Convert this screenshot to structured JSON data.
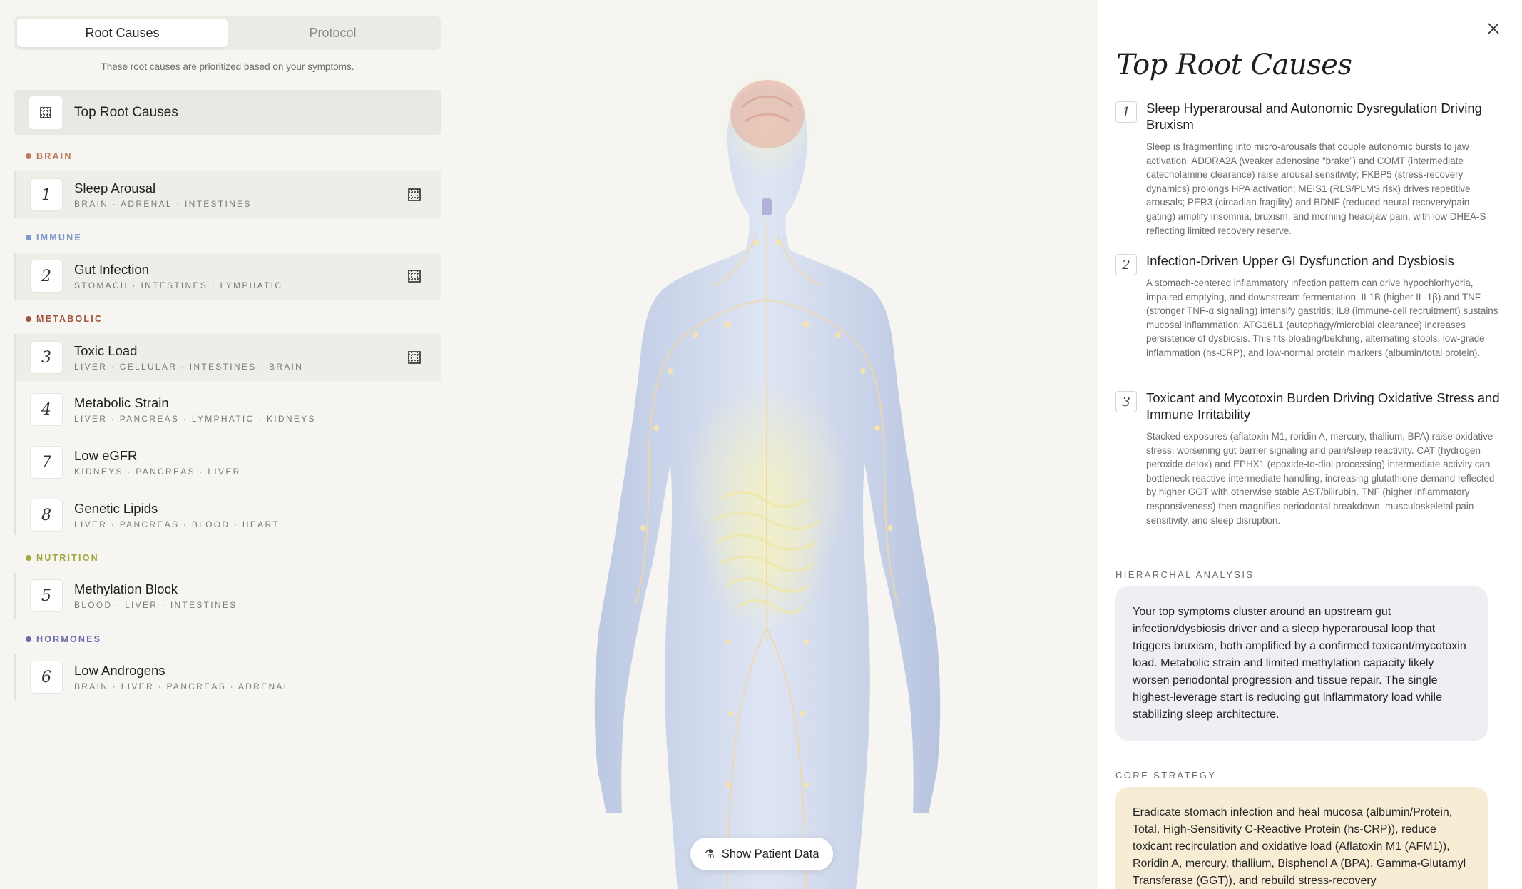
{
  "tabs": [
    {
      "label": "Root Causes",
      "active": true
    },
    {
      "label": "Protocol",
      "active": false
    }
  ],
  "subtitle": "These root causes are prioritized based on your symptoms.",
  "top_root_causes_label": "Top Root Causes",
  "categories": [
    {
      "name": "BRAIN",
      "color": "#c0775a"
    },
    {
      "name": "IMMUNE",
      "color": "#7a98c8"
    },
    {
      "name": "METABOLIC",
      "color": "#a0553c"
    },
    {
      "name": "NUTRITION",
      "color": "#a3a63c"
    },
    {
      "name": "HORMONES",
      "color": "#6a6aa8"
    }
  ],
  "items": [
    {
      "num": "1",
      "name": "Sleep Arousal",
      "organs": "BRAIN · ADRENAL · INTESTINES"
    },
    {
      "num": "2",
      "name": "Gut Infection",
      "organs": "STOMACH · INTESTINES · LYMPHATIC"
    },
    {
      "num": "3",
      "name": "Toxic Load",
      "organs": "LIVER · CELLULAR · INTESTINES · BRAIN"
    },
    {
      "num": "4",
      "name": "Metabolic Strain",
      "organs": "LIVER · PANCREAS · LYMPHATIC · KIDNEYS"
    },
    {
      "num": "7",
      "name": "Low eGFR",
      "organs": "KIDNEYS · PANCREAS · LIVER"
    },
    {
      "num": "8",
      "name": "Genetic Lipids",
      "organs": "LIVER · PANCREAS · BLOOD · HEART"
    },
    {
      "num": "5",
      "name": "Methylation Block",
      "organs": "BLOOD · LIVER · INTESTINES"
    },
    {
      "num": "6",
      "name": "Low Androgens",
      "organs": "BRAIN · LIVER · PANCREAS · ADRENAL"
    }
  ],
  "show_patient_data": "Show Patient Data",
  "panel": {
    "title": "Top Root Causes",
    "causes": [
      {
        "num": "1",
        "title": "Sleep Hyperarousal and Autonomic Dysregulation Driving Bruxism",
        "desc": "Sleep is fragmenting into micro-arousals that couple autonomic bursts to jaw activation. ADORA2A (weaker adenosine “brake”) and COMT (intermediate catecholamine clearance) raise arousal sensitivity; FKBP5 (stress-recovery dynamics) prolongs HPA activation; MEIS1 (RLS/PLMS risk) drives repetitive arousals; PER3 (circadian fragility) and BDNF (reduced neural recovery/pain gating) amplify insomnia, bruxism, and morning head/jaw pain, with low DHEA-S reflecting limited recovery reserve."
      },
      {
        "num": "2",
        "title": "Infection-Driven Upper GI Dysfunction and Dysbiosis",
        "desc": "A stomach-centered inflammatory infection pattern can drive hypochlorhydria, impaired emptying, and downstream fermentation. IL1B (higher IL-1β) and TNF (stronger TNF-α signaling) intensify gastritis; IL8 (immune-cell recruitment) sustains mucosal inflammation; ATG16L1 (autophagy/microbial clearance) increases persistence of dysbiosis. This fits bloating/belching, alternating stools, low-grade inflammation (hs-CRP), and low-normal protein markers (albumin/total protein)."
      },
      {
        "num": "3",
        "title": "Toxicant and Mycotoxin Burden Driving Oxidative Stress and Immune Irritability",
        "desc": "Stacked exposures (aflatoxin M1, roridin A, mercury, thallium, BPA) raise oxidative stress, worsening gut barrier signaling and pain/sleep reactivity. CAT (hydrogen peroxide detox) and EPHX1 (epoxide-to-diol processing) intermediate activity can bottleneck reactive intermediate handling, increasing glutathione demand reflected by higher GGT with otherwise stable AST/bilirubin. TNF (higher inflammatory responsiveness) then magnifies periodontal breakdown, musculoskeletal pain sensitivity, and sleep disruption."
      }
    ],
    "hier_label": "HIERARCHAL ANALYSIS",
    "hier_text": "Your top symptoms cluster around an upstream gut infection/dysbiosis driver and a sleep hyperarousal loop that triggers bruxism, both amplified by a confirmed toxicant/mycotoxin load. Metabolic strain and limited methylation capacity likely worsen periodontal progression and tissue repair. The single highest-leverage start is reducing gut inflammatory load while stabilizing sleep architecture.",
    "core_label": "CORE STRATEGY",
    "core_text": "Eradicate stomach infection and heal mucosa (albumin/Protein, Total, High-Sensitivity C-Reactive Protein (hs-CRP)), reduce toxicant recirculation and oxidative load (Aflatoxin M1 (AFM1)), Roridin A, mercury, thallium, Bisphenol A (BPA), Gamma-Glutamyl Transferase (GGT)), and rebuild stress-recovery"
  }
}
